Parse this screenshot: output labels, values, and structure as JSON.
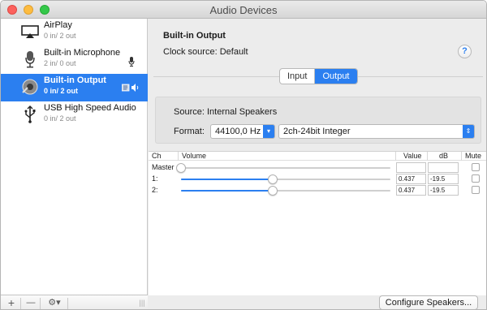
{
  "window": {
    "title": "Audio Devices"
  },
  "sidebar": {
    "devices": [
      {
        "name": "AirPlay",
        "channels": "0 in/ 2 out",
        "icon": "airplay-icon",
        "selected": false
      },
      {
        "name": "Built-in Microphone",
        "channels": "2 in/ 0 out",
        "icon": "microphone-icon",
        "selected": false
      },
      {
        "name": "Built-in Output",
        "channels": "0 in/ 2 out",
        "icon": "speaker-icon",
        "selected": true
      },
      {
        "name": "USB High Speed Audio",
        "channels": "0 in/ 2 out",
        "icon": "usb-icon",
        "selected": false
      }
    ],
    "footer": {
      "add": "+",
      "remove": "—",
      "gear": "⚙▾"
    }
  },
  "main": {
    "device_title": "Built-in Output",
    "clock_label": "Clock source:",
    "clock_value": "Default",
    "help": "?",
    "tabs": {
      "input": "Input",
      "output": "Output",
      "selected": "Output"
    },
    "source_label": "Source:",
    "source_value": "Internal Speakers",
    "format_label": "Format:",
    "sample_rate": "44100,0 Hz",
    "bit_format": "2ch-24bit Integer",
    "table": {
      "headers": {
        "ch": "Ch",
        "volume": "Volume",
        "value": "Value",
        "db": "dB",
        "mute": "Mute"
      },
      "rows": [
        {
          "ch": "Master",
          "level": 0.0,
          "value": "",
          "db": "",
          "muted": false
        },
        {
          "ch": "1:",
          "level": 0.437,
          "value": "0.437",
          "db": "-19.5",
          "muted": false
        },
        {
          "ch": "2:",
          "level": 0.437,
          "value": "0.437",
          "db": "-19.5",
          "muted": false
        }
      ]
    },
    "configure_button": "Configure Speakers..."
  },
  "colors": {
    "accent": "#2b7ff0",
    "close": "#fc615d",
    "minimize": "#fdbc40",
    "maximize": "#34c84a"
  }
}
